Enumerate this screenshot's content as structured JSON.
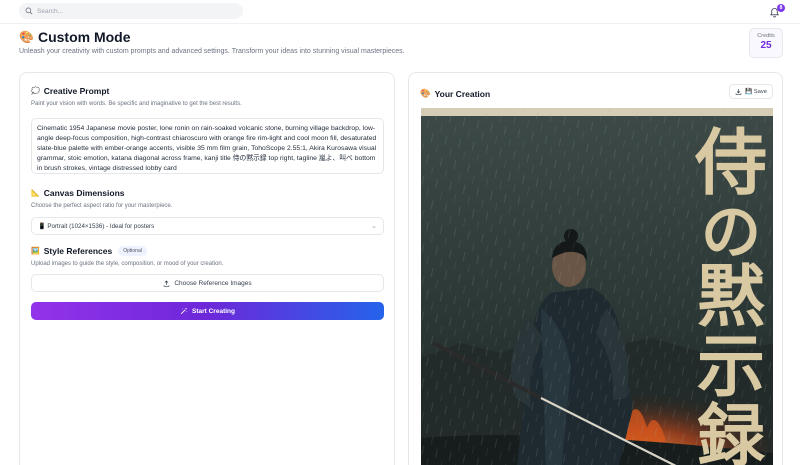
{
  "topbar": {
    "search_placeholder": "Search...",
    "notification_count": "8"
  },
  "header": {
    "title_emoji": "🎨",
    "title": "Custom Mode",
    "subtitle": "Unleash your creativity with custom prompts and advanced settings. Transform your ideas into stunning visual masterpieces.",
    "credits_label": "Credits",
    "credits_value": "25"
  },
  "prompt_section": {
    "icon": "💭",
    "title": "Creative Prompt",
    "description": "Paint your vision with words. Be specific and imaginative to get the best results.",
    "value": "Cinematic 1954 Japanese movie poster, lone ronin on rain-soaked volcanic stone, burning village backdrop, low-angle deep-focus composition, high-contrast chiaroscuro with orange fire rim-light and cool moon fill, desaturated slate-blue palette with ember-orange accents, visible 35 mm film grain, TohoScope 2.55:1, Akira Kurosawa visual grammar, stoic emotion, katana diagonal across frame, kanji title 侍の黙示録 top right, tagline 嵐よ、叫べ bottom in brush strokes, vintage distressed lobby card"
  },
  "canvas_section": {
    "icon": "📐",
    "title": "Canvas Dimensions",
    "description": "Choose the perfect aspect ratio for your masterpiece.",
    "selected": "📱 Portrait (1024×1536) - Ideal for posters"
  },
  "style_section": {
    "icon": "🖼️",
    "title": "Style References",
    "badge": "Optional",
    "description": "Upload images to guide the style, composition, or mood of your creation.",
    "upload_label": "Choose Reference Images"
  },
  "start_button": {
    "label": "Start Creating"
  },
  "creation": {
    "icon": "🎨",
    "title": "Your Creation",
    "save_label": "💾 Save",
    "poster_title_chars": [
      "侍",
      "の",
      "黙",
      "示",
      "録"
    ]
  }
}
